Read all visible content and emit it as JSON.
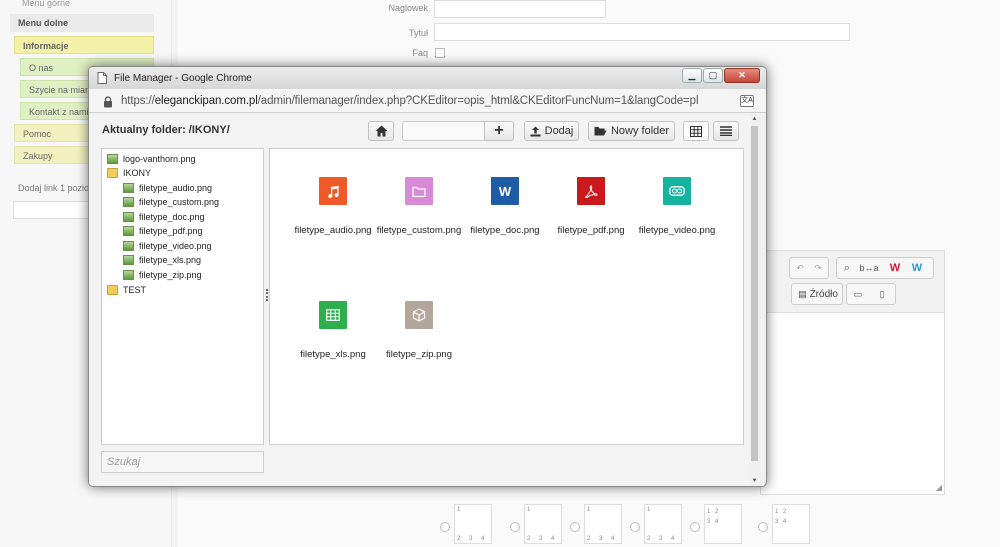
{
  "background": {
    "menu": {
      "top_item": "Menu górne",
      "bottom_heading": "Menu dolne",
      "items": [
        {
          "label": "Informacje"
        },
        {
          "label": "O nas"
        },
        {
          "label": "Szycie na miarę"
        },
        {
          "label": "Kontakt z nami"
        },
        {
          "label": "Pomoc"
        },
        {
          "label": "Zakupy"
        }
      ],
      "add_link_hint": "Dodaj link 1 poziomu"
    },
    "form": {
      "heading_label": "Naglowek",
      "title_label": "Tytuł",
      "faq_label": "Faq"
    },
    "editor": {
      "source_label": "Źródło"
    },
    "layouts": [
      {
        "numbers": [
          "1",
          "2",
          "3",
          "4"
        ]
      },
      {
        "numbers": [
          "1",
          "2",
          "3",
          "4"
        ]
      },
      {
        "numbers": [
          "1",
          "2",
          "3",
          "4"
        ]
      },
      {
        "numbers": [
          "1",
          "2",
          "3",
          "4"
        ]
      },
      {
        "numbers": [
          "1",
          "2",
          "3",
          "4"
        ]
      },
      {
        "numbers": [
          "1",
          "2",
          "3",
          "4"
        ]
      }
    ]
  },
  "popup": {
    "title": "File Manager - Google Chrome",
    "url_scheme": "https://",
    "url_host": "eleganckipan.com.pl",
    "url_path": "/admin/filemanager/index.php?CKEditor=opis_html&CKEditorFuncNum=1&langCode=pl",
    "file_manager": {
      "current_folder_label": "Aktualny folder:",
      "current_folder_path": "/IKONY/",
      "upload_label": "Dodaj",
      "new_folder_label": "Nowy folder",
      "search_placeholder": "Szukaj",
      "tree": [
        {
          "label": "logo-vanthorn.png",
          "type": "image"
        },
        {
          "label": "IKONY",
          "type": "folder-open"
        },
        {
          "label": "filetype_audio.png",
          "type": "image"
        },
        {
          "label": "filetype_custom.png",
          "type": "image"
        },
        {
          "label": "filetype_doc.png",
          "type": "image"
        },
        {
          "label": "filetype_pdf.png",
          "type": "image"
        },
        {
          "label": "filetype_video.png",
          "type": "image"
        },
        {
          "label": "filetype_xls.png",
          "type": "image"
        },
        {
          "label": "filetype_zip.png",
          "type": "image"
        },
        {
          "label": "TEST",
          "type": "folder"
        }
      ],
      "files": [
        {
          "name": "filetype_audio.png",
          "icon": "music-icon",
          "color": "#f05a28"
        },
        {
          "name": "filetype_custom.png",
          "icon": "folder-icon",
          "color": "#d88ad8"
        },
        {
          "name": "filetype_doc.png",
          "icon": "word-icon",
          "color": "#1f5ca8"
        },
        {
          "name": "filetype_pdf.png",
          "icon": "pdf-icon",
          "color": "#c8191c"
        },
        {
          "name": "filetype_video.png",
          "icon": "video-icon",
          "color": "#16b3a0"
        },
        {
          "name": "filetype_xls.png",
          "icon": "spreadsheet-icon",
          "color": "#2fae4f"
        },
        {
          "name": "filetype_zip.png",
          "icon": "archive-icon",
          "color": "#b3a79b"
        }
      ]
    }
  }
}
